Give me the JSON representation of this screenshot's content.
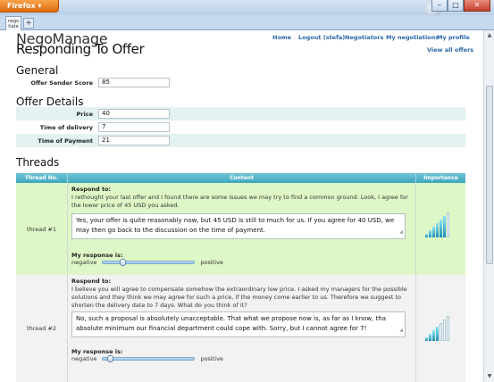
{
  "browser": {
    "button_label": "Firefox",
    "tab_label": "nego tiate",
    "new_tab": "+",
    "controls": [
      "–",
      "□",
      "✕"
    ]
  },
  "app": {
    "logo": "NegoManage",
    "page_title": "Responding To Offer",
    "nav": [
      "Home",
      "Logout (stefa)",
      "Negotiators",
      "My negotiations",
      "My profile"
    ],
    "view_all": "View all offers"
  },
  "general": {
    "heading": "General",
    "fields": [
      {
        "label": "Offer Sender Score",
        "value": "85"
      }
    ]
  },
  "offer_details": {
    "heading": "Offer Details",
    "fields": [
      {
        "label": "Price",
        "value": "40"
      },
      {
        "label": "Time of delivery",
        "value": "7"
      },
      {
        "label": "Time of Payment",
        "value": "21"
      }
    ]
  },
  "threads": {
    "heading": "Threads",
    "columns": [
      "Thread No.",
      "Content",
      "Importance"
    ],
    "rows": [
      {
        "id": "thread #1",
        "respond_label": "Respond to:",
        "offer_text": "I rethought your last offer and I found there are some issues we may try to find a common ground. Look, I agree for the lower price of 45 USD you asked.",
        "reply": "Yes, your offer is quite reasonably now, but 45 USD is still to much for us. If you agree for 40 USD, we may then go back to the discussion on the time of payment.",
        "response_label": "My response is:",
        "negative_label": "negative",
        "positive_label": "positive",
        "response_level": 0.2,
        "importance": 6
      },
      {
        "id": "thread #2",
        "respond_label": "Respond to:",
        "offer_text": "I believe you will agree to compensate somehow the extraordinary low price. I asked my managers for the possible solutions and they think we may agree for such a price, if the money come earlier to us. Therefore we suggest to shorten the delivery date to 7 days. What do you think of it?",
        "reply": "No, such a proposal is absolutely unacceptable. That what we propose now is, as far as I know, tha absolute minimum our financial department could cope with. Sorry, but I cannot agree for 7!",
        "response_label": "My response is:",
        "negative_label": "negative",
        "positive_label": "positive",
        "response_level": 0.05,
        "importance": 4
      }
    ]
  }
}
